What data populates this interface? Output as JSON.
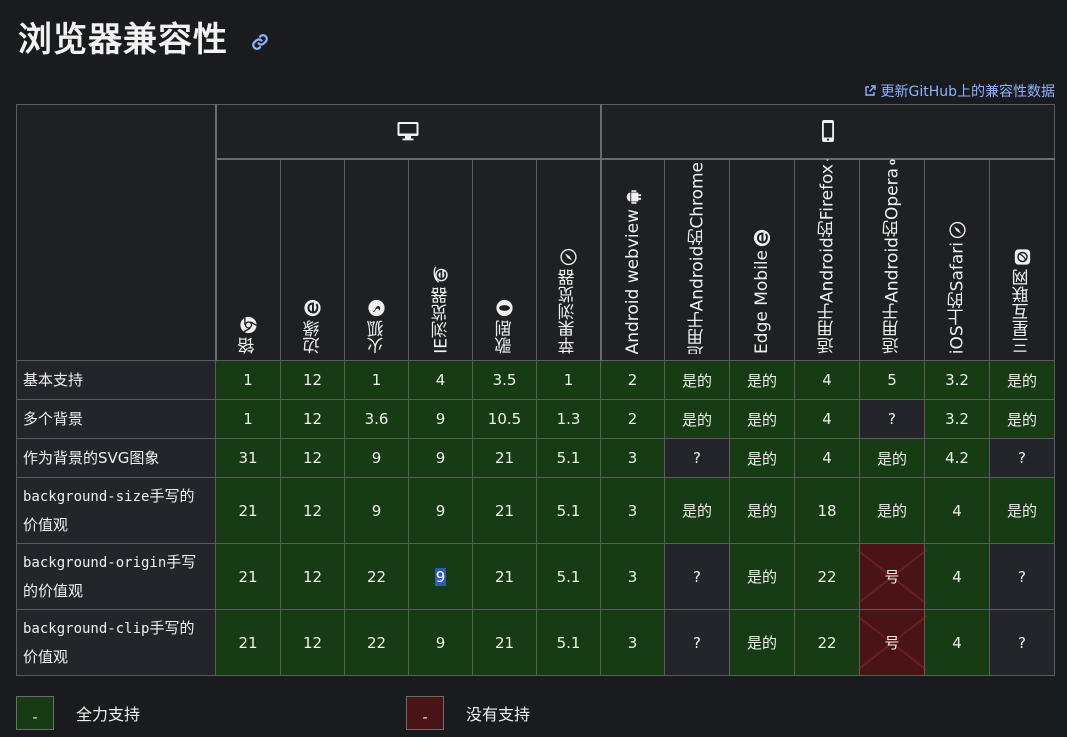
{
  "title": "浏览器兼容性",
  "update_link": "更新GitHub上的兼容性数据",
  "browsers": [
    {
      "label": "铬",
      "icon": "chrome-icon"
    },
    {
      "label": "边缘",
      "icon": "edge-icon"
    },
    {
      "label": "火狐",
      "icon": "firefox-icon"
    },
    {
      "label": "IE浏览器",
      "icon": "ie-icon"
    },
    {
      "label": "歌剧",
      "icon": "opera-icon"
    },
    {
      "label": "苹果浏览器",
      "icon": "safari-icon"
    },
    {
      "label": "Android webview",
      "icon": "android-icon"
    },
    {
      "label": "适用于Android的Chrome",
      "icon": "chrome-icon"
    },
    {
      "label": "Edge Mobile",
      "icon": "edge-icon"
    },
    {
      "label": "适用于Android的Firefox",
      "icon": "firefox-icon"
    },
    {
      "label": "适用于Android的Opera",
      "icon": "opera-icon"
    },
    {
      "label": "iOS上的Safari",
      "icon": "safari-icon"
    },
    {
      "label": "三星互联网",
      "icon": "samsung-icon"
    }
  ],
  "platforms": {
    "desktop_icon": "desktop-icon",
    "mobile_icon": "mobile-icon"
  },
  "features": [
    {
      "name": "基本支持",
      "cells": [
        [
          "1",
          "yes"
        ],
        [
          "12",
          "yes"
        ],
        [
          "1",
          "yes"
        ],
        [
          "4",
          "yes"
        ],
        [
          "3.5",
          "yes"
        ],
        [
          "1",
          "yes"
        ],
        [
          "2",
          "yes"
        ],
        [
          "是的",
          "yes"
        ],
        [
          "是的",
          "yes"
        ],
        [
          "4",
          "yes"
        ],
        [
          "5",
          "yes"
        ],
        [
          "3.2",
          "yes"
        ],
        [
          "是的",
          "yes"
        ]
      ]
    },
    {
      "name": "多个背景",
      "cells": [
        [
          "1",
          "yes"
        ],
        [
          "12",
          "yes"
        ],
        [
          "3.6",
          "yes"
        ],
        [
          "9",
          "yes"
        ],
        [
          "10.5",
          "yes"
        ],
        [
          "1.3",
          "yes"
        ],
        [
          "2",
          "yes"
        ],
        [
          "是的",
          "yes"
        ],
        [
          "是的",
          "yes"
        ],
        [
          "4",
          "yes"
        ],
        [
          "?",
          "unk"
        ],
        [
          "3.2",
          "yes"
        ],
        [
          "是的",
          "yes"
        ]
      ]
    },
    {
      "name": "作为背景的SVG图象",
      "cells": [
        [
          "31",
          "yes"
        ],
        [
          "12",
          "yes"
        ],
        [
          "9",
          "yes"
        ],
        [
          "9",
          "yes"
        ],
        [
          "21",
          "yes"
        ],
        [
          "5.1",
          "yes"
        ],
        [
          "3",
          "yes"
        ],
        [
          "?",
          "unk"
        ],
        [
          "是的",
          "yes"
        ],
        [
          "4",
          "yes"
        ],
        [
          "是的",
          "yes"
        ],
        [
          "4.2",
          "yes"
        ],
        [
          "?",
          "unk"
        ]
      ]
    },
    {
      "name_code": "background-size",
      "name_rest": "手写的价值观",
      "cells": [
        [
          "21",
          "yes"
        ],
        [
          "12",
          "yes"
        ],
        [
          "9",
          "yes"
        ],
        [
          "9",
          "yes"
        ],
        [
          "21",
          "yes"
        ],
        [
          "5.1",
          "yes"
        ],
        [
          "3",
          "yes"
        ],
        [
          "是的",
          "yes"
        ],
        [
          "是的",
          "yes"
        ],
        [
          "18",
          "yes"
        ],
        [
          "是的",
          "yes"
        ],
        [
          "4",
          "yes"
        ],
        [
          "是的",
          "yes"
        ]
      ]
    },
    {
      "name_code": "background-origin",
      "name_rest": "手写的价值观",
      "cells": [
        [
          "21",
          "yes"
        ],
        [
          "12",
          "yes"
        ],
        [
          "22",
          "yes"
        ],
        [
          "9",
          "yes-sel"
        ],
        [
          "21",
          "yes"
        ],
        [
          "5.1",
          "yes"
        ],
        [
          "3",
          "yes"
        ],
        [
          "?",
          "unk"
        ],
        [
          "是的",
          "yes"
        ],
        [
          "22",
          "yes"
        ],
        [
          "号",
          "no"
        ],
        [
          "4",
          "yes"
        ],
        [
          "?",
          "unk"
        ]
      ]
    },
    {
      "name_code": "background-clip",
      "name_rest": "手写的价值观",
      "cells": [
        [
          "21",
          "yes"
        ],
        [
          "12",
          "yes"
        ],
        [
          "22",
          "yes"
        ],
        [
          "9",
          "yes"
        ],
        [
          "21",
          "yes"
        ],
        [
          "5.1",
          "yes"
        ],
        [
          "3",
          "yes"
        ],
        [
          "?",
          "unk"
        ],
        [
          "是的",
          "yes"
        ],
        [
          "22",
          "yes"
        ],
        [
          "号",
          "no"
        ],
        [
          "4",
          "yes"
        ],
        [
          "?",
          "unk"
        ]
      ]
    }
  ],
  "legend": [
    {
      "swatch": "-",
      "label": "全力支持",
      "status": "yes"
    },
    {
      "swatch": "-",
      "label": "没有支持",
      "status": "no"
    }
  ]
}
